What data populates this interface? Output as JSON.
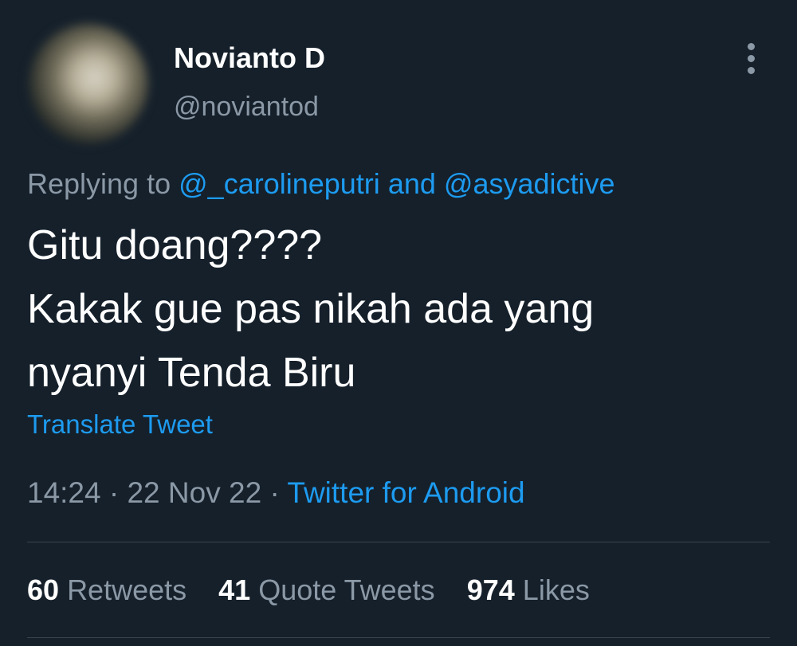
{
  "author": {
    "display_name": "Novianto D",
    "handle": "@noviantod"
  },
  "reply": {
    "prefix": "Replying to",
    "user1": "@_carolineputri",
    "conjunction": "and",
    "user2": "@asyadictive"
  },
  "tweet": {
    "lines": [
      "Gitu doang????",
      "Kakak gue pas nikah ada yang",
      "nyanyi Tenda Biru"
    ]
  },
  "translate_label": "Translate Tweet",
  "meta": {
    "time": "14:24",
    "separator": "·",
    "date": "22 Nov 22",
    "source": "Twitter for Android"
  },
  "stats": {
    "retweets": {
      "count": "60",
      "label": "Retweets"
    },
    "quote_tweets": {
      "count": "41",
      "label": "Quote Tweets"
    },
    "likes": {
      "count": "974",
      "label": "Likes"
    }
  },
  "colors": {
    "background": "#15202b",
    "accent": "#1d9bf0",
    "secondary_text": "#8b98a5",
    "divider": "#38444d"
  },
  "icons": {
    "more": "more-vertical-icon"
  }
}
